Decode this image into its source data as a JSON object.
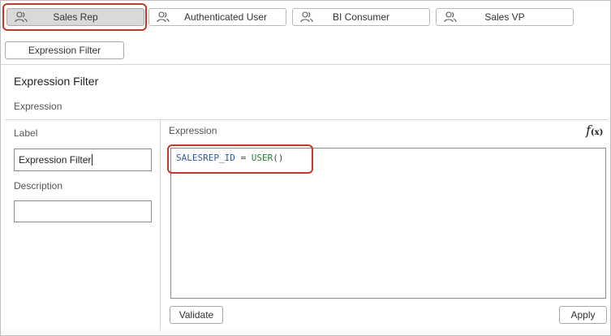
{
  "roles": [
    {
      "label": "Sales Rep",
      "active": true
    },
    {
      "label": "Authenticated User",
      "active": false
    },
    {
      "label": "BI Consumer",
      "active": false
    },
    {
      "label": "Sales VP",
      "active": false
    }
  ],
  "filter_tab": {
    "label": "Expression Filter"
  },
  "panel": {
    "title": "Expression Filter",
    "section": "Expression",
    "label_caption": "Label",
    "label_value": "Expression Filter",
    "description_caption": "Description",
    "description_value": ""
  },
  "editor": {
    "caption": "Expression",
    "fx_main": "f",
    "fx_sub": "(x)",
    "code": {
      "identifier": "SALESREP_ID",
      "operator": " = ",
      "function": "USER",
      "args": "()"
    }
  },
  "buttons": {
    "validate": "Validate",
    "apply": "Apply"
  },
  "colors": {
    "highlight": "#c0392b",
    "active_tab": "#d9d9d9"
  },
  "icons": {
    "role": "users-icon",
    "formula": "fx-icon"
  }
}
